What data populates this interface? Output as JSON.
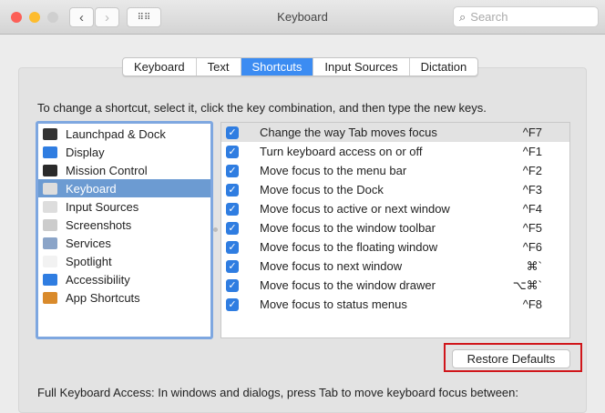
{
  "window": {
    "title": "Keyboard",
    "search_placeholder": "Search"
  },
  "tabs": [
    {
      "label": "Keyboard"
    },
    {
      "label": "Text"
    },
    {
      "label": "Shortcuts",
      "active": true
    },
    {
      "label": "Input Sources"
    },
    {
      "label": "Dictation"
    }
  ],
  "instructions": "To change a shortcut, select it, click the key combination, and then type the new keys.",
  "categories": [
    {
      "label": "Launchpad & Dock",
      "icon": "launchpad-icon",
      "color": "#333333"
    },
    {
      "label": "Display",
      "icon": "display-icon",
      "color": "#2f7de1"
    },
    {
      "label": "Mission Control",
      "icon": "mission-control-icon",
      "color": "#2a2a2a"
    },
    {
      "label": "Keyboard",
      "icon": "keyboard-icon",
      "color": "#dddddd",
      "selected": true
    },
    {
      "label": "Input Sources",
      "icon": "keyboard-icon",
      "color": "#dddddd"
    },
    {
      "label": "Screenshots",
      "icon": "screenshot-icon",
      "color": "#cccccc"
    },
    {
      "label": "Services",
      "icon": "gear-icon",
      "color": "#8aa4c8"
    },
    {
      "label": "Spotlight",
      "icon": "document-icon",
      "color": "#f2f2f2"
    },
    {
      "label": "Accessibility",
      "icon": "accessibility-icon",
      "color": "#2f7de1"
    },
    {
      "label": "App Shortcuts",
      "icon": "app-shortcuts-icon",
      "color": "#d98a2b"
    }
  ],
  "shortcuts": [
    {
      "label": "Change the way Tab moves focus",
      "key": "^F7",
      "checked": true,
      "selected": true
    },
    {
      "label": "Turn keyboard access on or off",
      "key": "^F1",
      "checked": true
    },
    {
      "label": "Move focus to the menu bar",
      "key": "^F2",
      "checked": true
    },
    {
      "label": "Move focus to the Dock",
      "key": "^F3",
      "checked": true
    },
    {
      "label": "Move focus to active or next window",
      "key": "^F4",
      "checked": true
    },
    {
      "label": "Move focus to the window toolbar",
      "key": "^F5",
      "checked": true
    },
    {
      "label": "Move focus to the floating window",
      "key": "^F6",
      "checked": true
    },
    {
      "label": "Move focus to next window",
      "key": "⌘`",
      "checked": true
    },
    {
      "label": "Move focus to the window drawer",
      "key": "⌥⌘`",
      "checked": true
    },
    {
      "label": "Move focus to status menus",
      "key": "^F8",
      "checked": true
    }
  ],
  "restore_label": "Restore Defaults",
  "full_access_text": "Full Keyboard Access: In windows and dialogs, press Tab to move keyboard focus between:"
}
